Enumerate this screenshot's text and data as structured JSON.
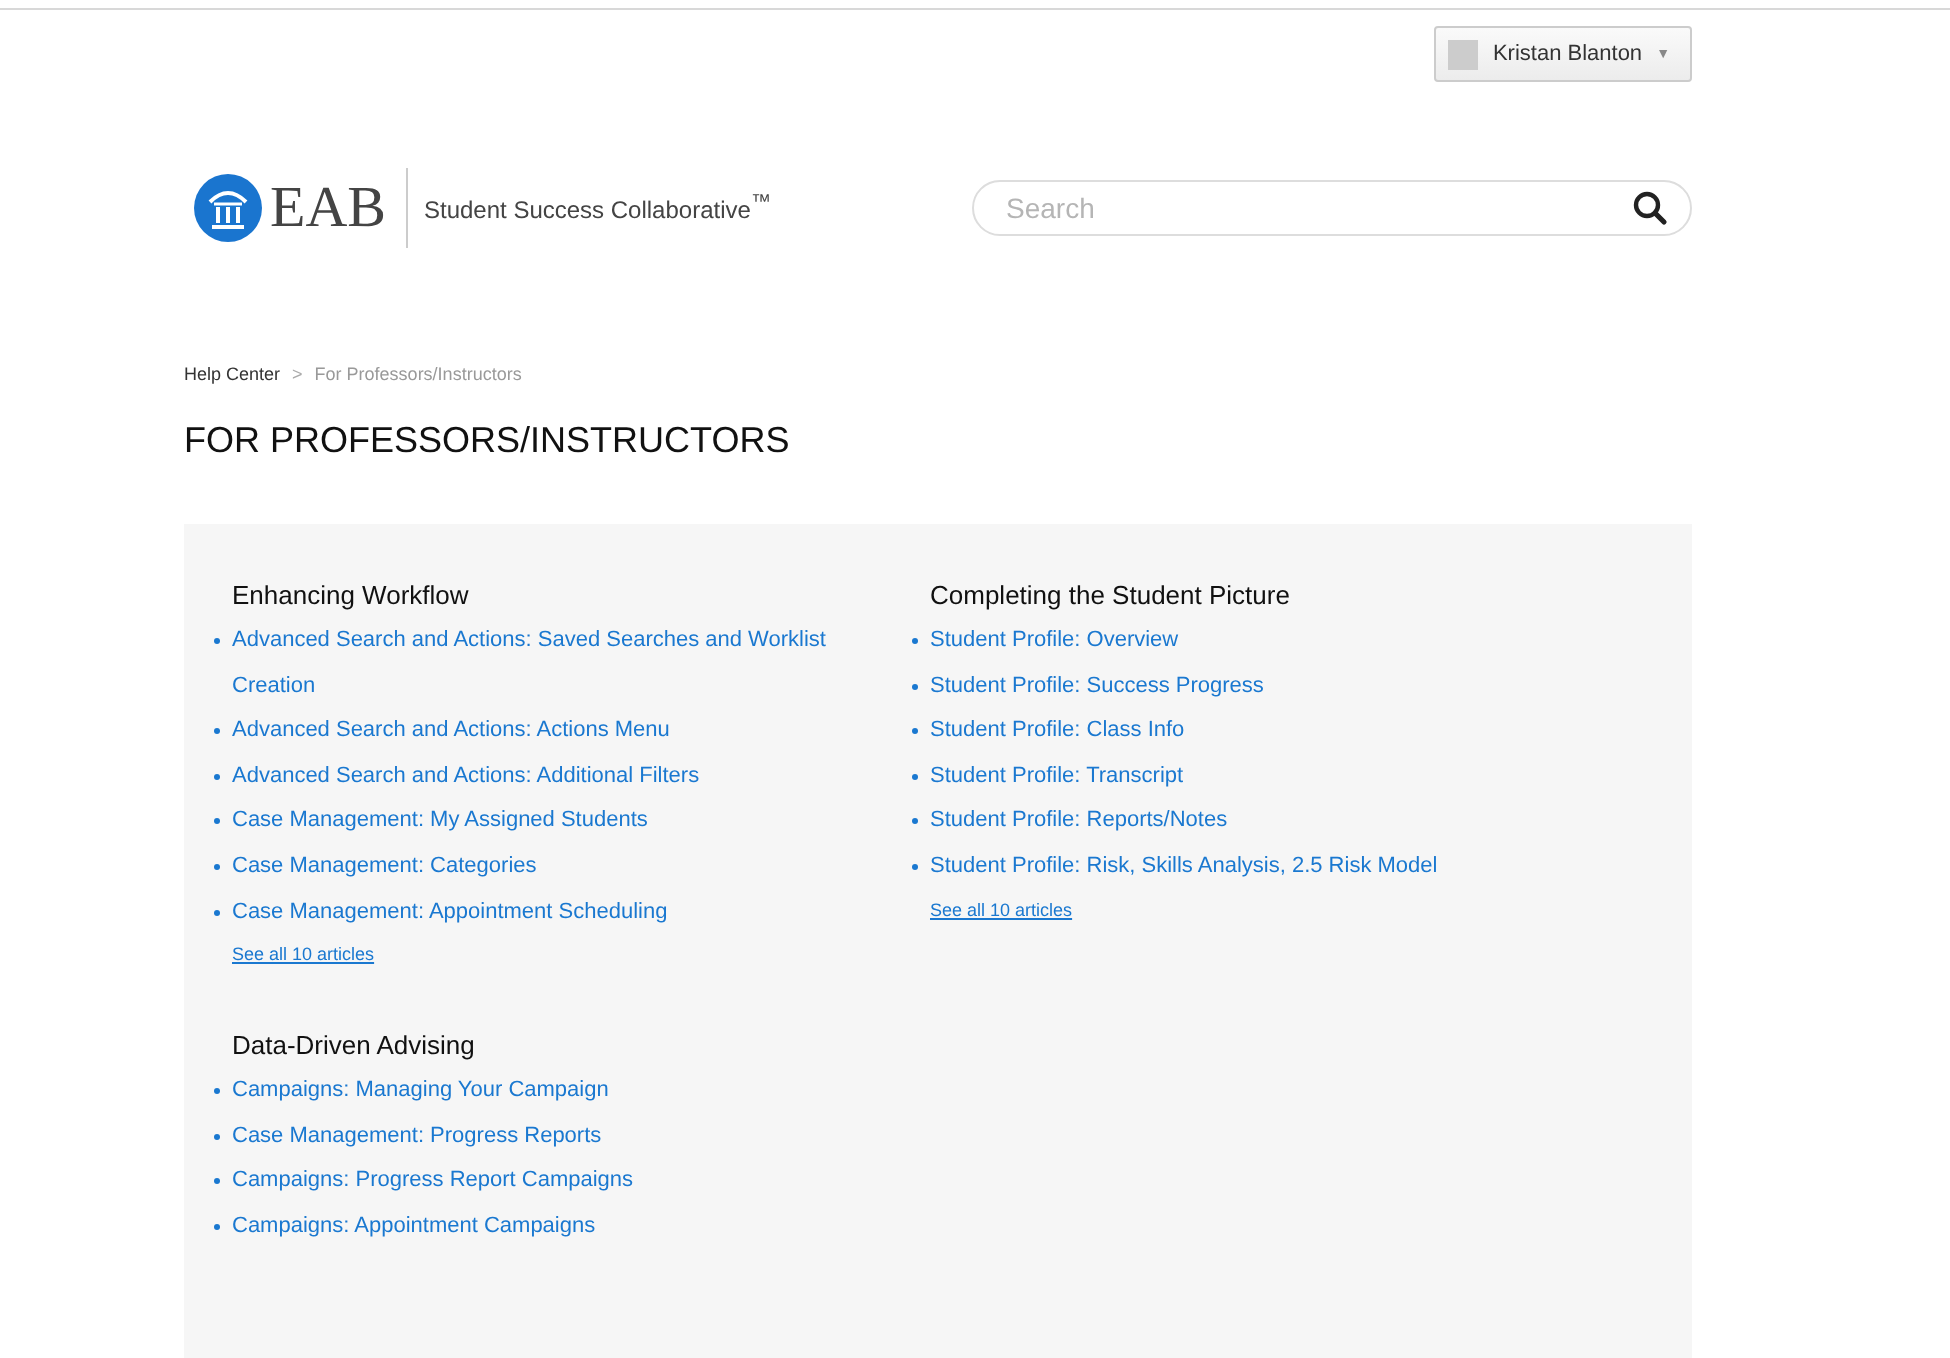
{
  "user_menu": {
    "name": "Kristan Blanton",
    "caret": "▼"
  },
  "logo": {
    "wordmark": "EAB",
    "product": "Student Success Collaborative$^{™}$"
  },
  "search": {
    "placeholder": "Search"
  },
  "breadcrumb": {
    "items": [
      {
        "label": "Help Center",
        "current": false
      },
      {
        "label": "For Professors/Instructors",
        "current": true
      }
    ],
    "separator": ">"
  },
  "page_title": "FOR PROFESSORS/INSTRUCTORS",
  "sections": [
    {
      "title": "Enhancing Workflow",
      "articles": [
        "Advanced Search and Actions: Saved Searches and Worklist Creation",
        "Advanced Search and Actions: Actions Menu",
        "Advanced Search and Actions: Additional Filters",
        "Case Management: My Assigned Students",
        "Case Management: Categories",
        "Case Management: Appointment Scheduling"
      ],
      "see_all": "See all 10 articles"
    },
    {
      "title": "Completing the Student Picture",
      "articles": [
        "Student Profile: Overview",
        "Student Profile: Success Progress",
        "Student Profile: Class Info",
        "Student Profile: Transcript",
        "Student Profile: Reports/Notes",
        "Student Profile: Risk, Skills Analysis, 2.5 Risk Model"
      ],
      "see_all": "See all 10 articles"
    },
    {
      "title": "Data-Driven Advising",
      "articles": [
        "Campaigns: Managing Your Campaign",
        "Case Management: Progress Reports",
        "Campaigns: Progress Report Campaigns",
        "Campaigns: Appointment Campaigns"
      ]
    }
  ]
}
